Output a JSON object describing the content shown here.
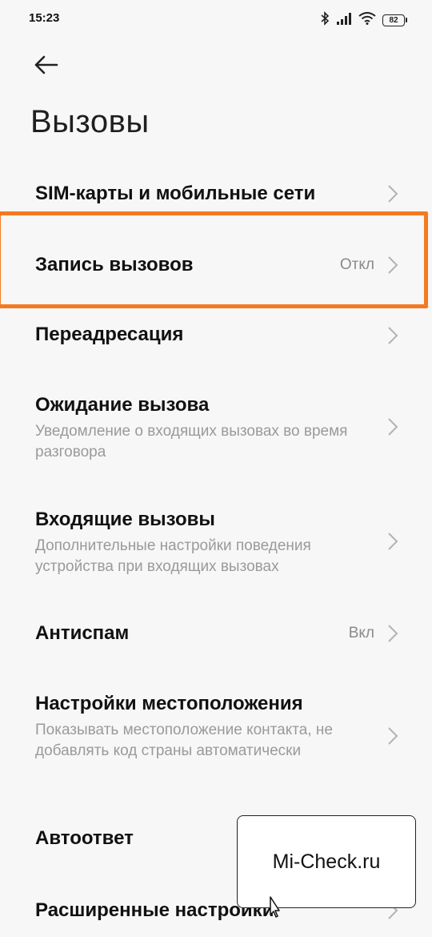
{
  "status": {
    "time": "15:23",
    "battery": "82"
  },
  "page": {
    "title": "Вызовы"
  },
  "items": [
    {
      "title": "SIM-карты и мобильные сети"
    },
    {
      "title": "Запись вызовов",
      "value": "Откл"
    },
    {
      "title": "Переадресация"
    },
    {
      "title": "Ожидание вызова",
      "subtitle": "Уведомление о входящих вызовах во время разговора"
    },
    {
      "title": "Входящие вызовы",
      "subtitle": "Дополнительные настройки поведения устройства при входящих вызовах"
    },
    {
      "title": "Антиспам",
      "value": "Вкл"
    },
    {
      "title": "Настройки местоположения",
      "subtitle": "Показывать местоположение контакта, не добавлять код страны автоматически"
    },
    {
      "title": "Автоответ"
    },
    {
      "title": "Расширенные настройки"
    }
  ],
  "highlight_color": "#f47920",
  "watermark": {
    "text": "Mi-Check.ru"
  },
  "icons": [
    "bluetooth-icon",
    "signal-icon",
    "wifi-icon",
    "battery-icon",
    "back-arrow-icon",
    "chevron-right-icon",
    "cursor-icon"
  ]
}
